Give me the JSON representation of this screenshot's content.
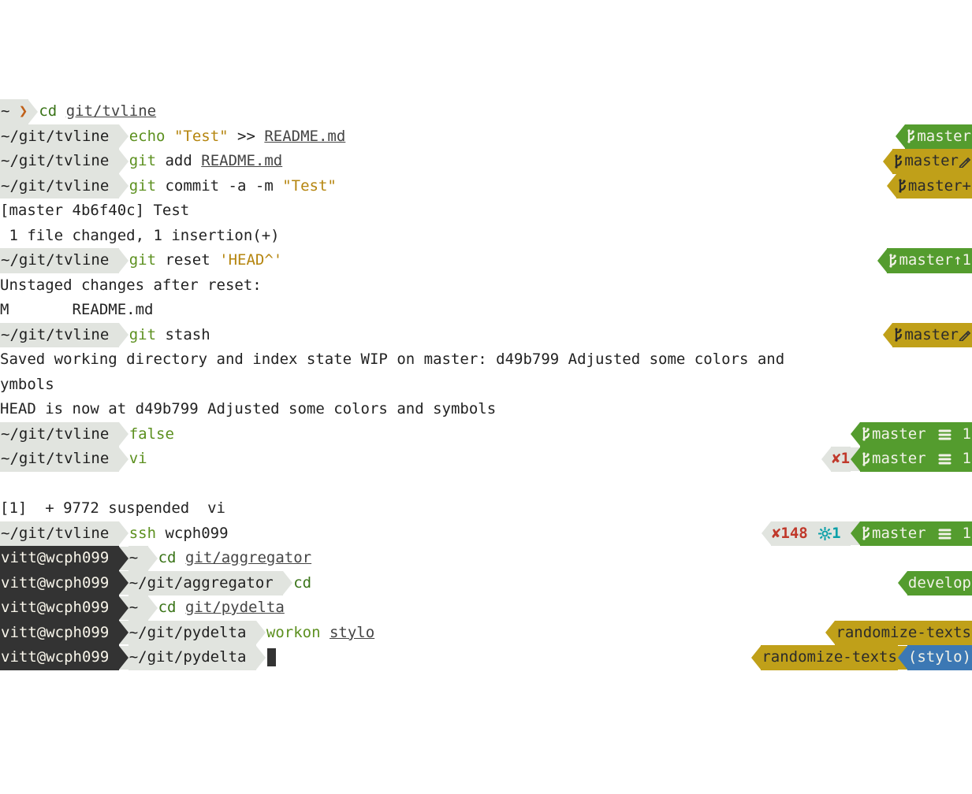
{
  "colors": {
    "gray": "#e1e4df",
    "dark": "#333333",
    "green": "#549c2e",
    "yellow": "#c0a019",
    "blue": "#3c78b4",
    "red": "#c0392b",
    "teal": "#0aa0a8",
    "orange": "#c06019"
  },
  "lines": [
    {
      "idx": 0,
      "left": {
        "host": null,
        "path": "~ ",
        "prompt": "❯",
        "parts": [
          {
            "text": "cd",
            "cls": "fg-darkgreen"
          },
          {
            "text": " "
          },
          {
            "text": "git/tvline",
            "cls": "fg-gray underline"
          }
        ]
      },
      "right": null
    },
    {
      "idx": 1,
      "left": {
        "host": null,
        "path": "~/git/tvline ",
        "parts": [
          {
            "text": "echo",
            "cls": "fg-green"
          },
          {
            "text": " "
          },
          {
            "text": "\"Test\"",
            "cls": "fg-yellow"
          },
          {
            "text": " >> "
          },
          {
            "text": "README.md",
            "cls": "fg-gray underline"
          }
        ]
      },
      "right": {
        "pre": [],
        "branch": {
          "bg": "green",
          "name": "master",
          "suffix": ""
        }
      }
    },
    {
      "idx": 2,
      "left": {
        "host": null,
        "path": "~/git/tvline ",
        "parts": [
          {
            "text": "git",
            "cls": "fg-green"
          },
          {
            "text": " add "
          },
          {
            "text": "README.md",
            "cls": "fg-gray underline"
          }
        ]
      },
      "right": {
        "pre": [],
        "branch": {
          "bg": "yellow",
          "name": "master",
          "suffix_pencil": true
        }
      }
    },
    {
      "idx": 3,
      "left": {
        "host": null,
        "path": "~/git/tvline ",
        "parts": [
          {
            "text": "git",
            "cls": "fg-green"
          },
          {
            "text": " commit -a -m "
          },
          {
            "text": "\"Test\"",
            "cls": "fg-yellow"
          }
        ]
      },
      "right": {
        "pre": [],
        "branch": {
          "bg": "yellow",
          "name": "master",
          "suffix": "+"
        }
      }
    },
    {
      "idx": 4,
      "plain": "[master 4b6f40c] Test"
    },
    {
      "idx": 5,
      "plain": " 1 file changed, 1 insertion(+)"
    },
    {
      "idx": 6,
      "left": {
        "host": null,
        "path": "~/git/tvline ",
        "parts": [
          {
            "text": "git",
            "cls": "fg-green"
          },
          {
            "text": " reset "
          },
          {
            "text": "'HEAD^'",
            "cls": "fg-yellow"
          }
        ]
      },
      "right": {
        "pre": [],
        "branch": {
          "bg": "green",
          "name": "master",
          "suffix": "↑1"
        }
      }
    },
    {
      "idx": 7,
      "plain": "Unstaged changes after reset:"
    },
    {
      "idx": 8,
      "plain": "M       README.md"
    },
    {
      "idx": 9,
      "left": {
        "host": null,
        "path": "~/git/tvline ",
        "parts": [
          {
            "text": "git",
            "cls": "fg-green"
          },
          {
            "text": " stash"
          }
        ]
      },
      "right": {
        "pre": [],
        "branch": {
          "bg": "yellow",
          "name": "master",
          "suffix_pencil": true
        }
      }
    },
    {
      "idx": 10,
      "plain": "Saved working directory and index state WIP on master: d49b799 Adjusted some colors and "
    },
    {
      "idx": 11,
      "plain": "ymbols"
    },
    {
      "idx": 12,
      "plain": "HEAD is now at d49b799 Adjusted some colors and symbols"
    },
    {
      "idx": 13,
      "left": {
        "host": null,
        "path": "~/git/tvline ",
        "parts": [
          {
            "text": "false",
            "cls": "fg-green"
          }
        ]
      },
      "right": {
        "pre": [],
        "branch": {
          "bg": "green",
          "name": "master ",
          "identical": true,
          "suffix": " 1"
        }
      }
    },
    {
      "idx": 14,
      "left": {
        "host": null,
        "path": "~/git/tvline ",
        "parts": [
          {
            "text": "vi",
            "cls": "fg-green"
          }
        ]
      },
      "right": {
        "pre": [
          {
            "t": "x",
            "v": "✘1",
            "cls": "fg-red",
            "bg": "bg-gray"
          }
        ],
        "branch": {
          "bg": "green",
          "name": "master ",
          "identical": true,
          "suffix": " 1"
        }
      }
    },
    {
      "idx": 15,
      "plain": ""
    },
    {
      "idx": 16,
      "plain": "[1]  + 9772 suspended  vi"
    },
    {
      "idx": 17,
      "left": {
        "host": null,
        "path": "~/git/tvline ",
        "parts": [
          {
            "text": "ssh",
            "cls": "fg-green"
          },
          {
            "text": " wcph099"
          }
        ]
      },
      "right": {
        "pre": [
          {
            "t": "x",
            "v": "✘148 ",
            "cls": "fg-red",
            "bg": "bg-gray"
          },
          {
            "t": "g",
            "v": "1 ",
            "cls": "fg-teal",
            "bg": "bg-gray"
          }
        ],
        "branch": {
          "bg": "green",
          "name": "master ",
          "identical": true,
          "suffix": " 1"
        }
      }
    },
    {
      "idx": 18,
      "left": {
        "host": "vitt@wcph099 ",
        "path": "~ ",
        "parts": [
          {
            "text": "cd",
            "cls": "fg-darkgreen"
          },
          {
            "text": " "
          },
          {
            "text": "git/aggregator",
            "cls": "fg-gray underline"
          }
        ]
      },
      "right": null
    },
    {
      "idx": 19,
      "left": {
        "host": "vitt@wcph099 ",
        "path": "~/git/aggregator ",
        "parts": [
          {
            "text": "cd",
            "cls": "fg-darkgreen"
          }
        ]
      },
      "right": {
        "pre": [],
        "branch": {
          "bg": "green",
          "name": "develop",
          "nobranchicon": true
        }
      }
    },
    {
      "idx": 20,
      "left": {
        "host": "vitt@wcph099 ",
        "path": "~ ",
        "parts": [
          {
            "text": "cd",
            "cls": "fg-darkgreen"
          },
          {
            "text": " "
          },
          {
            "text": "git/pydelta",
            "cls": "fg-gray underline"
          }
        ]
      },
      "right": null
    },
    {
      "idx": 21,
      "left": {
        "host": "vitt@wcph099 ",
        "path": "~/git/pydelta ",
        "parts": [
          {
            "text": "workon",
            "cls": "fg-green"
          },
          {
            "text": " "
          },
          {
            "text": "stylo",
            "cls": "fg-gray underline"
          }
        ]
      },
      "right": {
        "pre": [],
        "branch": {
          "bg": "yellow",
          "name": "randomize-texts",
          "nobranchicon": true
        }
      }
    },
    {
      "idx": 22,
      "left": {
        "host": "vitt@wcph099 ",
        "path": "~/git/pydelta ",
        "parts": [
          {
            "cursor": true
          }
        ]
      },
      "right": {
        "branch": {
          "bg": "yellow",
          "name": "randomize-texts",
          "nobranchicon": true
        },
        "venv": {
          "bg": "blue",
          "name": "(stylo)"
        }
      }
    }
  ]
}
